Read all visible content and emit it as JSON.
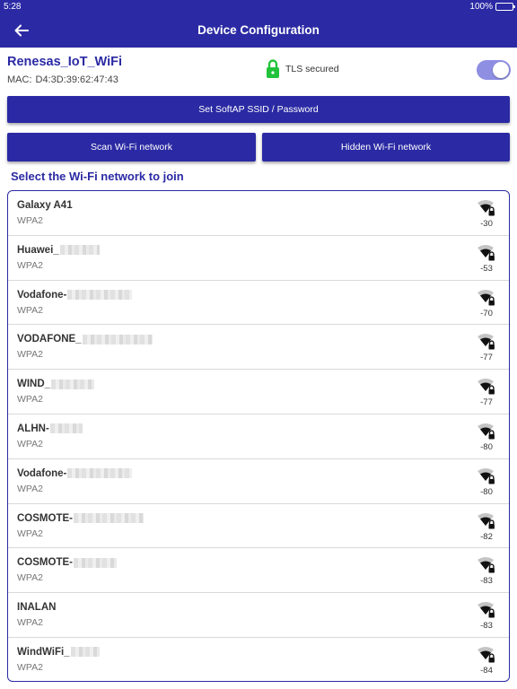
{
  "status_bar": {
    "time": "5:28",
    "battery": "100%"
  },
  "app_bar": {
    "title": "Device Configuration"
  },
  "device": {
    "name": "Renesas_IoT_WiFi",
    "mac_label": "MAC:",
    "mac": "D4:3D:39:62:47:43",
    "tls_label": "TLS secured",
    "toggle_on": true
  },
  "buttons": {
    "softap": "Set SoftAP SSID / Password",
    "scan": "Scan Wi-Fi network",
    "hidden": "Hidden Wi-Fi network"
  },
  "section": {
    "title": "Select the Wi-Fi network to join"
  },
  "networks": [
    {
      "ssid": "Galaxy A41",
      "security": "WPA2",
      "rssi": "-30"
    },
    {
      "ssid": "Huawei_",
      "security": "WPA2",
      "rssi": "-53"
    },
    {
      "ssid": "Vodafone-",
      "security": "WPA2",
      "rssi": "-70"
    },
    {
      "ssid": "VODAFONE_",
      "security": "WPA2",
      "rssi": "-77"
    },
    {
      "ssid": "WIND_",
      "security": "WPA2",
      "rssi": "-77"
    },
    {
      "ssid": "ALHN-",
      "security": "WPA2",
      "rssi": "-80"
    },
    {
      "ssid": "Vodafone-",
      "security": "WPA2",
      "rssi": "-80"
    },
    {
      "ssid": "COSMOTE-",
      "security": "WPA2",
      "rssi": "-82"
    },
    {
      "ssid": "COSMOTE-",
      "security": "WPA2",
      "rssi": "-83"
    },
    {
      "ssid": "INALAN",
      "security": "WPA2",
      "rssi": "-83"
    },
    {
      "ssid": "WindWiFi_",
      "security": "WPA2",
      "rssi": "-84"
    }
  ],
  "colors": {
    "primary": "#2b2aa4",
    "toggle_track": "#8e8ee3",
    "lock_green": "#22c33a"
  },
  "icons": {
    "back": "arrow-left-icon",
    "tls": "lock-icon",
    "signal": "wifi-lock-icon"
  }
}
